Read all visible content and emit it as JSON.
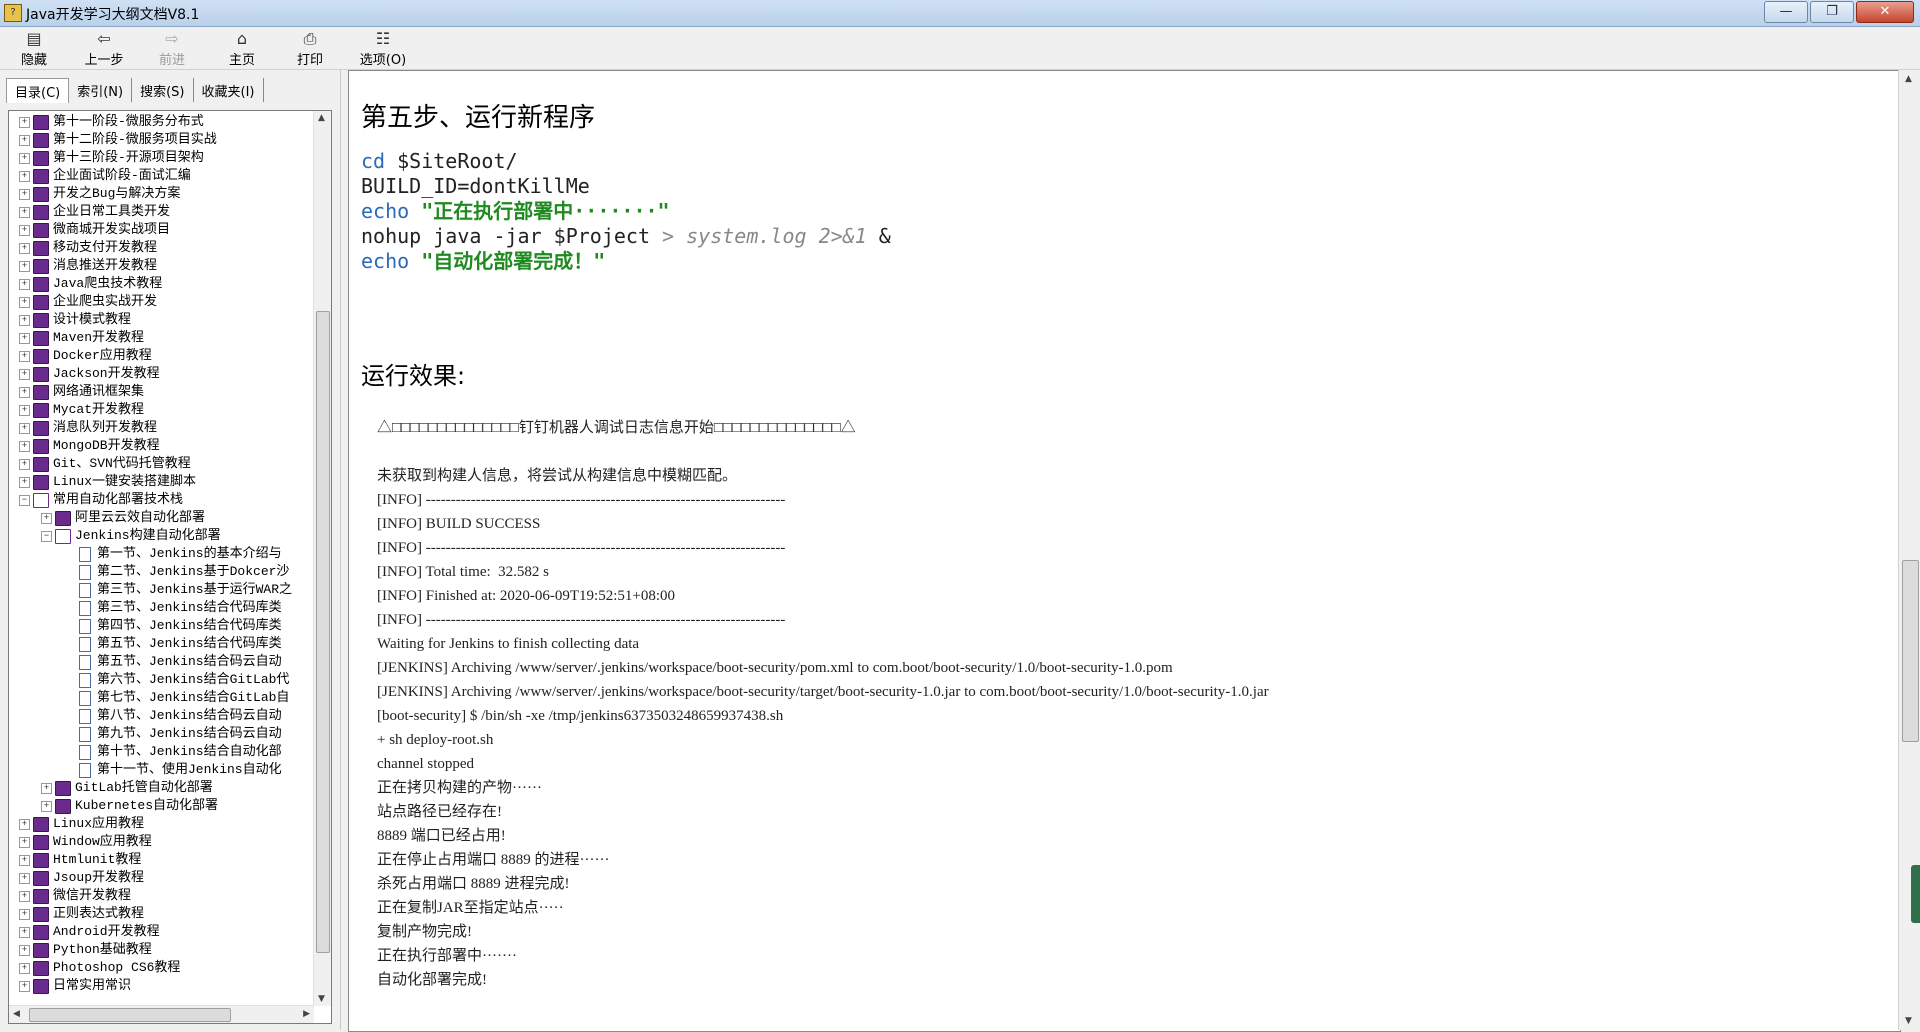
{
  "window": {
    "title": "Java开发学习大纲文档V8.1",
    "min": "—",
    "max": "❐",
    "close": "✕"
  },
  "toolbar": {
    "hide": "隐藏",
    "back": "上一步",
    "forward": "前进",
    "home": "主页",
    "print": "打印",
    "options": "选项(O)"
  },
  "tabs": [
    "目录(C)",
    "索引(N)",
    "搜索(S)",
    "收藏夹(I)"
  ],
  "tree": [
    {
      "level": 0,
      "expander": "+",
      "icon": "book",
      "label": "第十一阶段-微服务分布式"
    },
    {
      "level": 0,
      "expander": "+",
      "icon": "book",
      "label": "第十二阶段-微服务项目实战"
    },
    {
      "level": 0,
      "expander": "+",
      "icon": "book",
      "label": "第十三阶段-开源项目架构"
    },
    {
      "level": 0,
      "expander": "+",
      "icon": "book",
      "label": "企业面试阶段-面试汇编"
    },
    {
      "level": 0,
      "expander": "+",
      "icon": "book",
      "label": "开发之Bug与解决方案"
    },
    {
      "level": 0,
      "expander": "+",
      "icon": "book",
      "label": "企业日常工具类开发"
    },
    {
      "level": 0,
      "expander": "+",
      "icon": "book",
      "label": "微商城开发实战项目"
    },
    {
      "level": 0,
      "expander": "+",
      "icon": "book",
      "label": "移动支付开发教程"
    },
    {
      "level": 0,
      "expander": "+",
      "icon": "book",
      "label": "消息推送开发教程"
    },
    {
      "level": 0,
      "expander": "+",
      "icon": "book",
      "label": "Java爬虫技术教程"
    },
    {
      "level": 0,
      "expander": "+",
      "icon": "book",
      "label": "企业爬虫实战开发"
    },
    {
      "level": 0,
      "expander": "+",
      "icon": "book",
      "label": "设计模式教程"
    },
    {
      "level": 0,
      "expander": "+",
      "icon": "book",
      "label": "Maven开发教程"
    },
    {
      "level": 0,
      "expander": "+",
      "icon": "book",
      "label": "Docker应用教程"
    },
    {
      "level": 0,
      "expander": "+",
      "icon": "book",
      "label": "Jackson开发教程"
    },
    {
      "level": 0,
      "expander": "+",
      "icon": "book",
      "label": "网络通讯框架集"
    },
    {
      "level": 0,
      "expander": "+",
      "icon": "book",
      "label": "Mycat开发教程"
    },
    {
      "level": 0,
      "expander": "+",
      "icon": "book",
      "label": "消息队列开发教程"
    },
    {
      "level": 0,
      "expander": "+",
      "icon": "book",
      "label": "MongoDB开发教程"
    },
    {
      "level": 0,
      "expander": "+",
      "icon": "book",
      "label": "Git、SVN代码托管教程"
    },
    {
      "level": 0,
      "expander": "+",
      "icon": "book",
      "label": "Linux一键安装搭建脚本"
    },
    {
      "level": 0,
      "expander": "−",
      "icon": "book-open",
      "label": "常用自动化部署技术栈"
    },
    {
      "level": 1,
      "expander": "+",
      "icon": "book",
      "label": "阿里云云效自动化部署"
    },
    {
      "level": 1,
      "expander": "−",
      "icon": "book-open",
      "label": "Jenkins构建自动化部署"
    },
    {
      "level": 2,
      "expander": "",
      "icon": "page",
      "label": "第一节、Jenkins的基本介绍与"
    },
    {
      "level": 2,
      "expander": "",
      "icon": "page",
      "label": "第二节、Jenkins基于Dokcer沙"
    },
    {
      "level": 2,
      "expander": "",
      "icon": "page",
      "label": "第三节、Jenkins基于运行WAR之"
    },
    {
      "level": 2,
      "expander": "",
      "icon": "page",
      "label": "第三节、Jenkins结合代码库类"
    },
    {
      "level": 2,
      "expander": "",
      "icon": "page",
      "label": "第四节、Jenkins结合代码库类"
    },
    {
      "level": 2,
      "expander": "",
      "icon": "page",
      "label": "第五节、Jenkins结合代码库类"
    },
    {
      "level": 2,
      "expander": "",
      "icon": "page",
      "label": "第五节、Jenkins结合码云自动"
    },
    {
      "level": 2,
      "expander": "",
      "icon": "page",
      "label": "第六节、Jenkins结合GitLab代"
    },
    {
      "level": 2,
      "expander": "",
      "icon": "page",
      "label": "第七节、Jenkins结合GitLab自"
    },
    {
      "level": 2,
      "expander": "",
      "icon": "page",
      "label": "第八节、Jenkins结合码云自动"
    },
    {
      "level": 2,
      "expander": "",
      "icon": "page",
      "label": "第九节、Jenkins结合码云自动"
    },
    {
      "level": 2,
      "expander": "",
      "icon": "page",
      "label": "第十节、Jenkins结合自动化部"
    },
    {
      "level": 2,
      "expander": "",
      "icon": "page",
      "label": "第十一节、使用Jenkins自动化"
    },
    {
      "level": 1,
      "expander": "+",
      "icon": "book",
      "label": "GitLab托管自动化部署"
    },
    {
      "level": 1,
      "expander": "+",
      "icon": "book",
      "label": "Kubernetes自动化部署"
    },
    {
      "level": 0,
      "expander": "+",
      "icon": "book",
      "label": "Linux应用教程"
    },
    {
      "level": 0,
      "expander": "+",
      "icon": "book",
      "label": "Window应用教程"
    },
    {
      "level": 0,
      "expander": "+",
      "icon": "book",
      "label": "Htmlunit教程"
    },
    {
      "level": 0,
      "expander": "+",
      "icon": "book",
      "label": "Jsoup开发教程"
    },
    {
      "level": 0,
      "expander": "+",
      "icon": "book",
      "label": "微信开发教程"
    },
    {
      "level": 0,
      "expander": "+",
      "icon": "book",
      "label": "正则表达式教程"
    },
    {
      "level": 0,
      "expander": "+",
      "icon": "book",
      "label": "Android开发教程"
    },
    {
      "level": 0,
      "expander": "+",
      "icon": "book",
      "label": "Python基础教程"
    },
    {
      "level": 0,
      "expander": "+",
      "icon": "book",
      "label": "Photoshop CS6教程"
    },
    {
      "level": 0,
      "expander": "+",
      "icon": "book",
      "label": "日常实用常识"
    }
  ],
  "content": {
    "heading": "第五步、运行新程序",
    "code": {
      "l1_kw": "cd",
      "l1_rest": " $SiteRoot/",
      "l2": "BUILD_ID=dontKillMe",
      "l3_kw": "echo",
      "l3_str": " \"正在执行部署中·······\"",
      "l4_a": "nohup java -jar $Project ",
      "l4_b": "> system.log 2>&1",
      "l4_c": " &",
      "l5_kw": "echo",
      "l5_str": " \"自动化部署完成！\""
    },
    "result_heading": "运行效果:",
    "log_lines": [
      "△□□□□□□□□□□□□□□钉钉机器人调试日志信息开始□□□□□□□□□□□□□□△",
      "",
      "未获取到构建人信息，将尝试从构建信息中模糊匹配。",
      "[INFO] ------------------------------------------------------------------------",
      "[INFO] BUILD SUCCESS",
      "[INFO] ------------------------------------------------------------------------",
      "[INFO] Total time:  32.582 s",
      "[INFO] Finished at: 2020-06-09T19:52:51+08:00",
      "[INFO] ------------------------------------------------------------------------",
      "Waiting for Jenkins to finish collecting data",
      "[JENKINS] Archiving /www/server/.jenkins/workspace/boot-security/pom.xml to com.boot/boot-security/1.0/boot-security-1.0.pom",
      "[JENKINS] Archiving /www/server/.jenkins/workspace/boot-security/target/boot-security-1.0.jar to com.boot/boot-security/1.0/boot-security-1.0.jar",
      "[boot-security] $ /bin/sh -xe /tmp/jenkins6373503248659937438.sh",
      "+ sh deploy-root.sh",
      "channel stopped",
      "正在拷贝构建的产物······",
      "站点路径已经存在!",
      "8889 端口已经占用!",
      "正在停止占用端口 8889 的进程······",
      "杀死占用端口 8889 进程完成!",
      "正在复制JAR至指定站点·····",
      "复制产物完成!",
      "正在执行部署中·······",
      "自动化部署完成!"
    ]
  }
}
